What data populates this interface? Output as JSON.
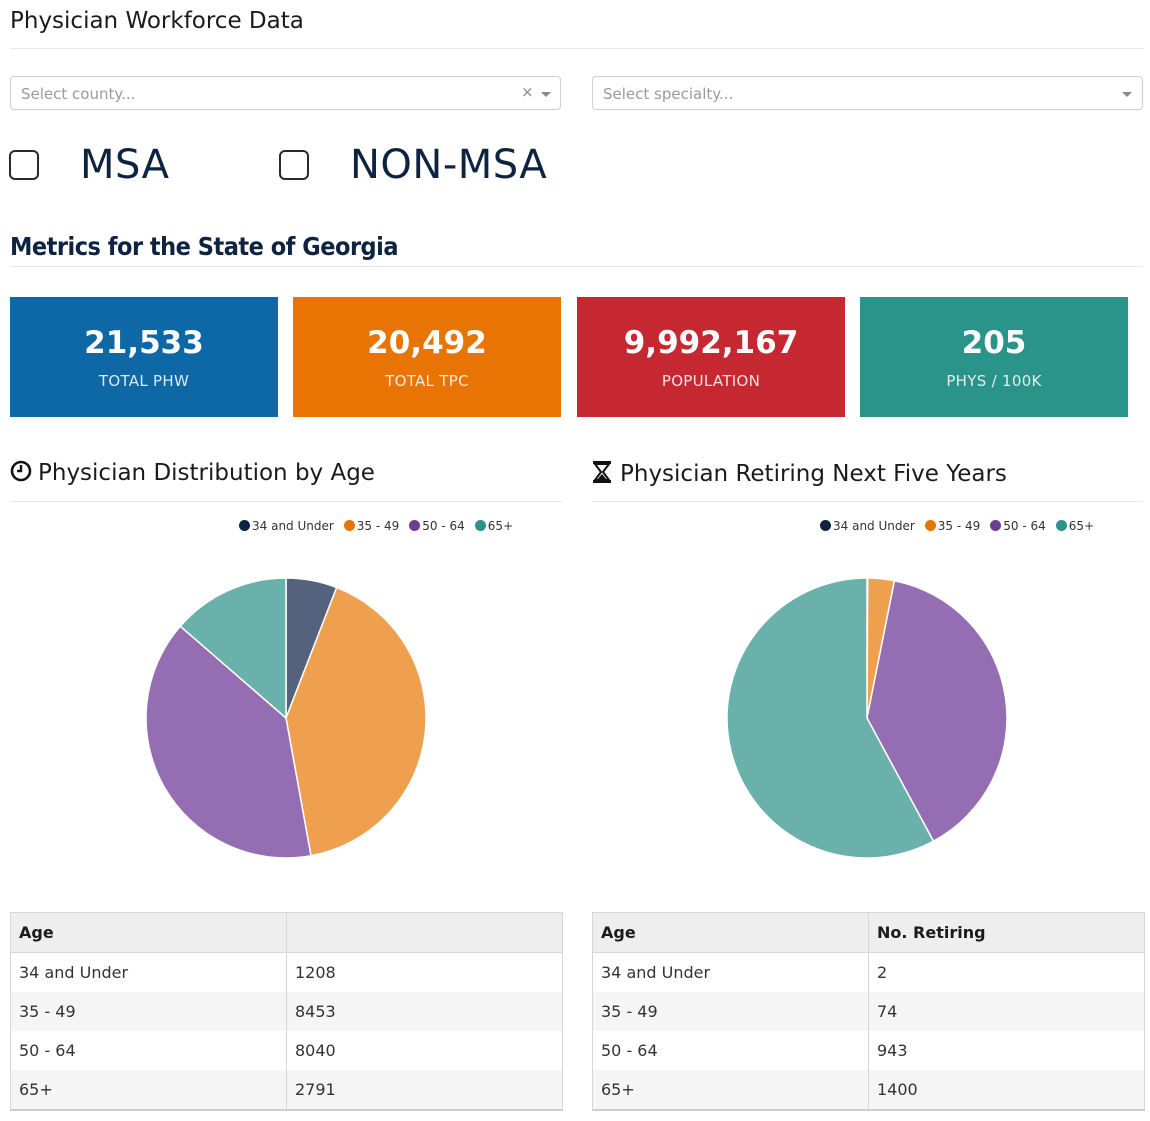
{
  "title": "Physician Workforce Data",
  "county_select": {
    "placeholder": "Select county...",
    "clear": "×"
  },
  "specialty_select": {
    "placeholder": "Select specialty..."
  },
  "checkboxes": [
    {
      "label": "MSA"
    },
    {
      "label": "NON-MSA"
    }
  ],
  "metrics_heading": "Metrics for the State of Georgia",
  "cards": [
    {
      "value": "21,533",
      "label": "TOTAL PHW",
      "color": "#0e68a5"
    },
    {
      "value": "20,492",
      "label": "TOTAL TPC",
      "color": "#e87503"
    },
    {
      "value": "9,992,167",
      "label": "POPULATION",
      "color": "#c62832"
    },
    {
      "value": "205",
      "label": "PHYS / 100K",
      "color": "#2a938a"
    }
  ],
  "colors": {
    "34 and Under": "#55627d",
    "35 - 49": "#eea04f",
    "50 - 64": "#956db3",
    "65+": "#6ab1ab",
    "legend": {
      "34 and Under": "#0d2340",
      "35 - 49": "#e87503",
      "50 - 64": "#6c3d91",
      "65+": "#2a938a"
    }
  },
  "sections": [
    {
      "title": "Physician Distribution by Age",
      "icon": "clock-icon"
    },
    {
      "title": "Physician Retiring Next Five Years",
      "icon": "hourglass-icon"
    }
  ],
  "chart_data": [
    {
      "type": "pie",
      "categories": [
        "34 and Under",
        "35 - 49",
        "50 - 64",
        "65+"
      ],
      "values": [
        1208,
        8453,
        8040,
        2791
      ],
      "legend_position": "top-right"
    },
    {
      "type": "pie",
      "categories": [
        "34 and Under",
        "35 - 49",
        "50 - 64",
        "65+"
      ],
      "values": [
        2,
        74,
        943,
        1400
      ],
      "legend_position": "top-right"
    }
  ],
  "tables": [
    {
      "headers": [
        "Age",
        ""
      ],
      "rows": [
        [
          "34 and Under",
          "1208"
        ],
        [
          "35 - 49",
          "8453"
        ],
        [
          "50 - 64",
          "8040"
        ],
        [
          "65+",
          "2791"
        ]
      ]
    },
    {
      "headers": [
        "Age",
        "No. Retiring"
      ],
      "rows": [
        [
          "34 and Under",
          "2"
        ],
        [
          "35 - 49",
          "74"
        ],
        [
          "50 - 64",
          "943"
        ],
        [
          "65+",
          "1400"
        ]
      ]
    }
  ]
}
